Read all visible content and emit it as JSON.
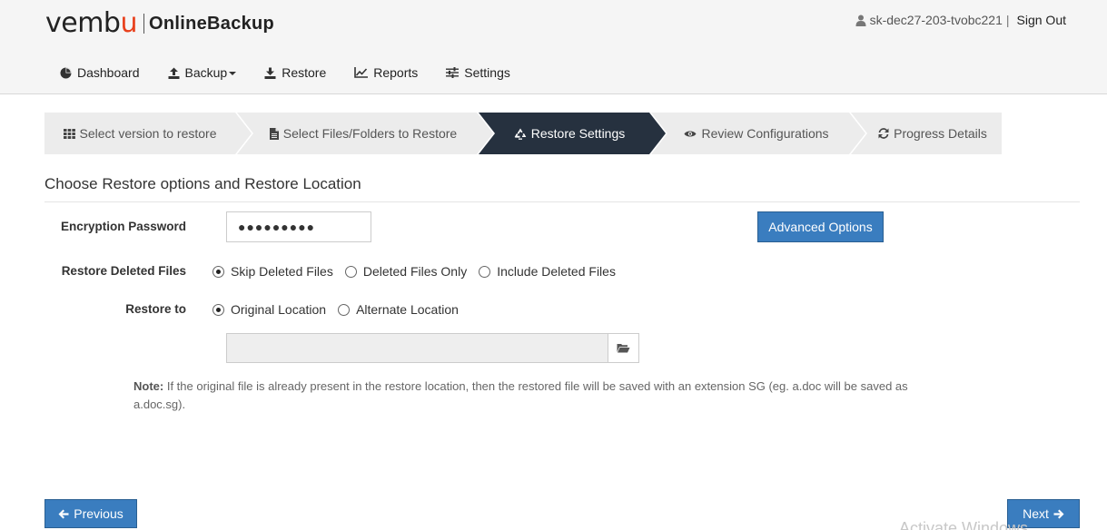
{
  "header": {
    "logo_brand": "vembu",
    "logo_product": "OnlineBackup",
    "username": "sk-dec27-203-tvobc221",
    "separator": "|",
    "sign_out": "Sign Out"
  },
  "nav": {
    "items": [
      {
        "label": "Dashboard",
        "icon": "pie-chart-icon"
      },
      {
        "label": "Backup",
        "icon": "upload-icon",
        "has_dropdown": true
      },
      {
        "label": "Restore",
        "icon": "download-icon"
      },
      {
        "label": "Reports",
        "icon": "line-chart-icon"
      },
      {
        "label": "Settings",
        "icon": "sliders-icon"
      }
    ]
  },
  "wizard": {
    "steps": [
      {
        "label": "Select version to restore",
        "icon": "grid-icon",
        "active": false
      },
      {
        "label": "Select Files/Folders to Restore",
        "icon": "file-icon",
        "active": false
      },
      {
        "label": "Restore Settings",
        "icon": "recycle-icon",
        "active": true
      },
      {
        "label": "Review Configurations",
        "icon": "eye-icon",
        "active": false
      },
      {
        "label": "Progress Details",
        "icon": "refresh-icon",
        "active": false
      }
    ]
  },
  "form": {
    "title": "Choose Restore options and Restore Location",
    "encryption_label": "Encryption Password",
    "encryption_value": "●●●●●●●●●",
    "advanced_button": "Advanced Options",
    "deleted_label": "Restore Deleted Files",
    "deleted_options": [
      {
        "label": "Skip Deleted Files",
        "checked": true
      },
      {
        "label": "Deleted Files Only",
        "checked": false
      },
      {
        "label": "Include Deleted Files",
        "checked": false
      }
    ],
    "restore_to_label": "Restore to",
    "restore_to_options": [
      {
        "label": "Original Location",
        "checked": true
      },
      {
        "label": "Alternate Location",
        "checked": false
      }
    ],
    "path_value": "",
    "note_label": "Note:",
    "note_text": " If the original file is already present in the restore location, then the restored file will be saved with an extension SG (eg. a.doc will be saved as a.doc.sg)."
  },
  "footer": {
    "previous": "Previous",
    "next": "Next",
    "watermark": "Activate Windows"
  },
  "colors": {
    "primary_button": "#3a7dbf",
    "active_step": "#26313f",
    "inactive_step": "#ececec",
    "brand_accent": "#e8401c"
  }
}
